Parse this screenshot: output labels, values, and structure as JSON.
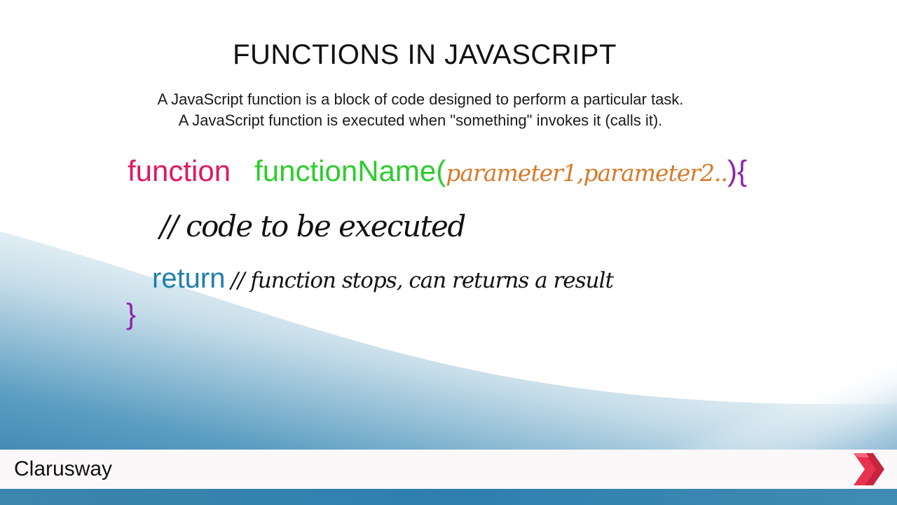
{
  "slide": {
    "title": "FUNCTIONS IN JAVASCRIPT",
    "description": [
      "A JavaScript function is a block of code designed to perform a particular task.",
      "A JavaScript function is executed when \"something\" invokes it (calls it)."
    ],
    "code": {
      "keyword_function": "function",
      "function_name": "functionName",
      "open_paren": "(",
      "parameters": "parameter1,parameter2..",
      "close_paren": ")",
      "open_brace": "{",
      "body_comment": "// code to be executed",
      "keyword_return": "return",
      "return_comment": "// function stops, can returns a result",
      "close_brace": "}"
    }
  },
  "footer": {
    "brand": "Clarusway",
    "logo_icon": "clarusway-chevron-logo-icon"
  },
  "colors": {
    "keyword_function": "#e0185a",
    "function_name": "#2ccd2c",
    "parameters": "#d77a2a",
    "braces": "#8e24aa",
    "keyword_return": "#1f7fa8",
    "wave_blue": "#2f7fae",
    "logo_red": "#e8334f"
  }
}
